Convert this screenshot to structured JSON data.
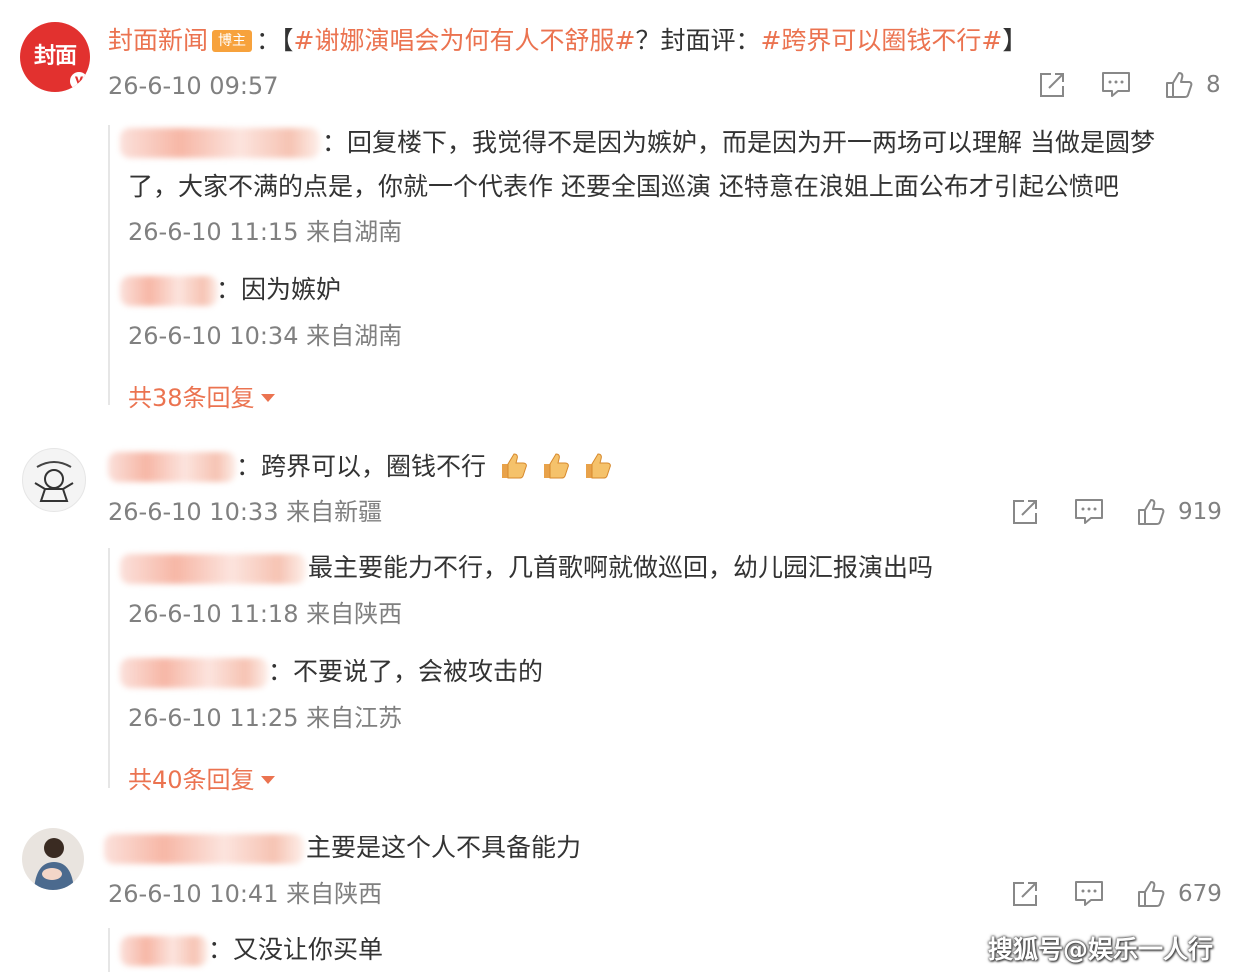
{
  "post": {
    "author": "封面新闻",
    "badge": "博主",
    "colon": "：",
    "bracket_open": "【",
    "topic1": "#谢娜演唱会为何有人不舒服#",
    "mid_text": "？封面评：",
    "topic2": "#跨界可以圈钱不行#",
    "bracket_close": "】",
    "time": "26-6-10 09:57",
    "likes": "8",
    "avatar_text": "封面",
    "replies": [
      {
        "text1": "：回复楼下，我觉得不是因为嫉妒，而是因为开一两场可以理解 当做是圆梦",
        "text2": "了，大家不满的点是，你就一个代表作 还要全国巡演 还特意在浪姐上面公布才引起公愤吧",
        "time": "26-6-10 11:15 来自湖南"
      },
      {
        "text": "：因为嫉妒",
        "time": "26-6-10 10:34 来自湖南"
      }
    ],
    "more": "共38条回复"
  },
  "comment1": {
    "text": "：跨界可以，圈钱不行",
    "time": "26-6-10 10:33 来自新疆",
    "likes": "919",
    "replies": [
      {
        "text": "最主要能力不行，几首歌啊就做巡回，幼儿园汇报演出吗",
        "time": "26-6-10 11:18 来自陕西"
      },
      {
        "text": "：不要说了，会被攻击的",
        "time": "26-6-10 11:25 来自江苏"
      }
    ],
    "more": "共40条回复"
  },
  "comment2": {
    "text": "主要是这个人不具备能力",
    "time": "26-6-10 10:41 来自陕西",
    "likes": "679",
    "replies": [
      {
        "text": "：又没让你买单"
      }
    ]
  },
  "watermark": "搜狐号@娱乐一人行",
  "icons": [
    "share-icon",
    "comment-icon",
    "like-icon",
    "thumbs-up-emoji"
  ],
  "colors": {
    "accent": "#eb7350",
    "meta": "#808080",
    "avatar_red": "#e2312f"
  }
}
